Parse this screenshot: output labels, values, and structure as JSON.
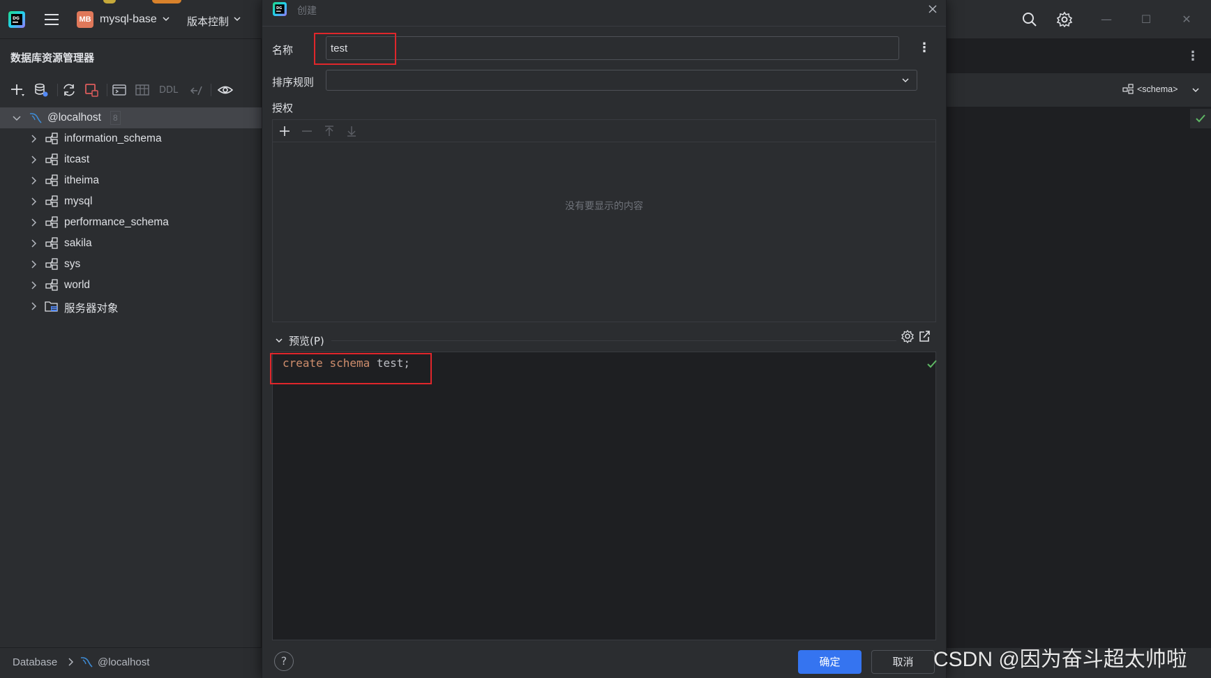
{
  "app": {
    "project_badge": "MB",
    "project_name": "mysql-base",
    "vcs_label": "版本控制"
  },
  "explorer": {
    "title": "数据库资源管理器",
    "toolbar": {
      "ddl_label": "DDL"
    },
    "tree": {
      "root": {
        "label": "@localhost",
        "count": "8"
      },
      "items": [
        {
          "label": "information_schema"
        },
        {
          "label": "itcast"
        },
        {
          "label": "itheima"
        },
        {
          "label": "mysql"
        },
        {
          "label": "performance_schema"
        },
        {
          "label": "sakila"
        },
        {
          "label": "sys"
        },
        {
          "label": "world"
        },
        {
          "label": "服务器对象"
        }
      ]
    }
  },
  "statusbar": {
    "crumb1": "Database",
    "crumb2": "@localhost"
  },
  "editor": {
    "schema_selector": "<schema>"
  },
  "dialog": {
    "title": "创建",
    "name_label": "名称",
    "name_value": "test",
    "collation_label": "排序规则",
    "collation_value": "",
    "grant_label": "授权",
    "grant_empty": "没有要显示的内容",
    "preview_label": "预览(P)",
    "code": {
      "kw1": "create",
      "kw2": "schema",
      "rest": " test;"
    },
    "help": "?",
    "ok_label": "确定",
    "cancel_label": "取消"
  },
  "watermark": "CSDN @因为奋斗超太帅啦",
  "colors": {
    "accent": "#3574f0",
    "highlight": "#e0262b",
    "keyword": "#cf8e6d",
    "ok_check": "#5fb865",
    "badge": "#e0785a"
  }
}
